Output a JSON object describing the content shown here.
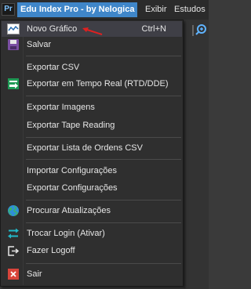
{
  "menubar": {
    "logo_text": "Pr",
    "title": "Edu Index Pro - by Nelogica",
    "items": [
      "Exibir",
      "Estudos"
    ]
  },
  "menu": {
    "items": [
      {
        "label": "Novo Gráfico",
        "shortcut": "Ctrl+N",
        "icon": "chart-line-icon"
      },
      {
        "label": "Salvar",
        "icon": "save-disk-icon"
      },
      {
        "label": "Exportar CSV"
      },
      {
        "label": "Exportar em Tempo Real (RTD/DDE)",
        "icon": "export-realtime-icon"
      },
      {
        "label": "Exportar Imagens"
      },
      {
        "label": "Exportar Tape Reading"
      },
      {
        "label": "Exportar Lista de Ordens CSV"
      },
      {
        "label": "Importar Configurações"
      },
      {
        "label": "Exportar Configurações"
      },
      {
        "label": "Procurar Atualizações",
        "icon": "globe-icon"
      },
      {
        "label": "Trocar Login (Ativar)",
        "icon": "swap-arrows-icon"
      },
      {
        "label": "Fazer Logoff",
        "icon": "logoff-icon"
      },
      {
        "label": "Sair",
        "icon": "close-icon"
      }
    ]
  },
  "colors": {
    "accent": "#3f86c9",
    "menu_bg": "#2f2f2f",
    "arrow": "#e02020"
  }
}
